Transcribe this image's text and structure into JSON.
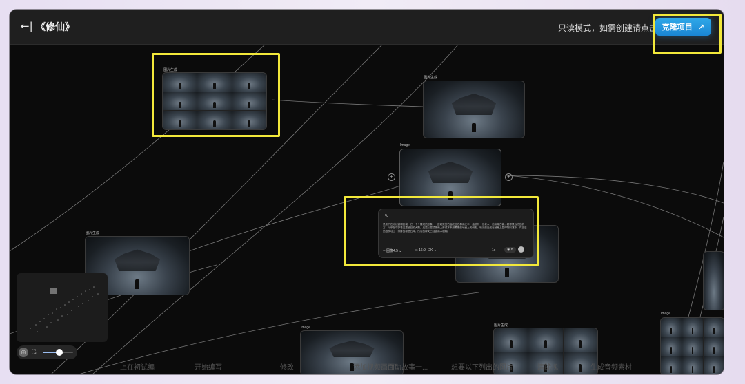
{
  "header": {
    "back_label": "←|",
    "title": "《修仙》",
    "readonly_notice": "只读模式，如需创建请点击",
    "clone_button": "克隆项目",
    "clone_icon": "↗"
  },
  "nodes": {
    "image_gen_label": "图片生成",
    "image_label": "Image"
  },
  "prompt": {
    "text": "黑影不在光线微弱区域，它一个个展现的形象，一座破败的古庙屹立在暴雨之中，庙前有一位老人，他身穿古装，看得很远的在前方，似乎在守护着这里破旧的大殿，庙里从屋顶漏雨上形成下来积蓄着的地面上的倒影，暗淡的光线在他身上显得特别凄冷，向古庙的庭院地上一排排的都是石碑，所有的碑文已经被雨水模糊。",
    "model": "图像4.5",
    "ratio": "16:9 · 2K",
    "count": "1x",
    "credits": "8"
  },
  "zoom": {
    "level": 0.55
  },
  "bottom_texts": [
    "上在初试编",
    "开始编写",
    "修改",
    "添加视频画面助故事一...",
    "想要以下列出的图片",
    "清除视",
    "生成音频素材"
  ],
  "colors": {
    "accent": "#1f95de",
    "highlight": "#f2e83a",
    "canvas": "#0b0b0b"
  }
}
